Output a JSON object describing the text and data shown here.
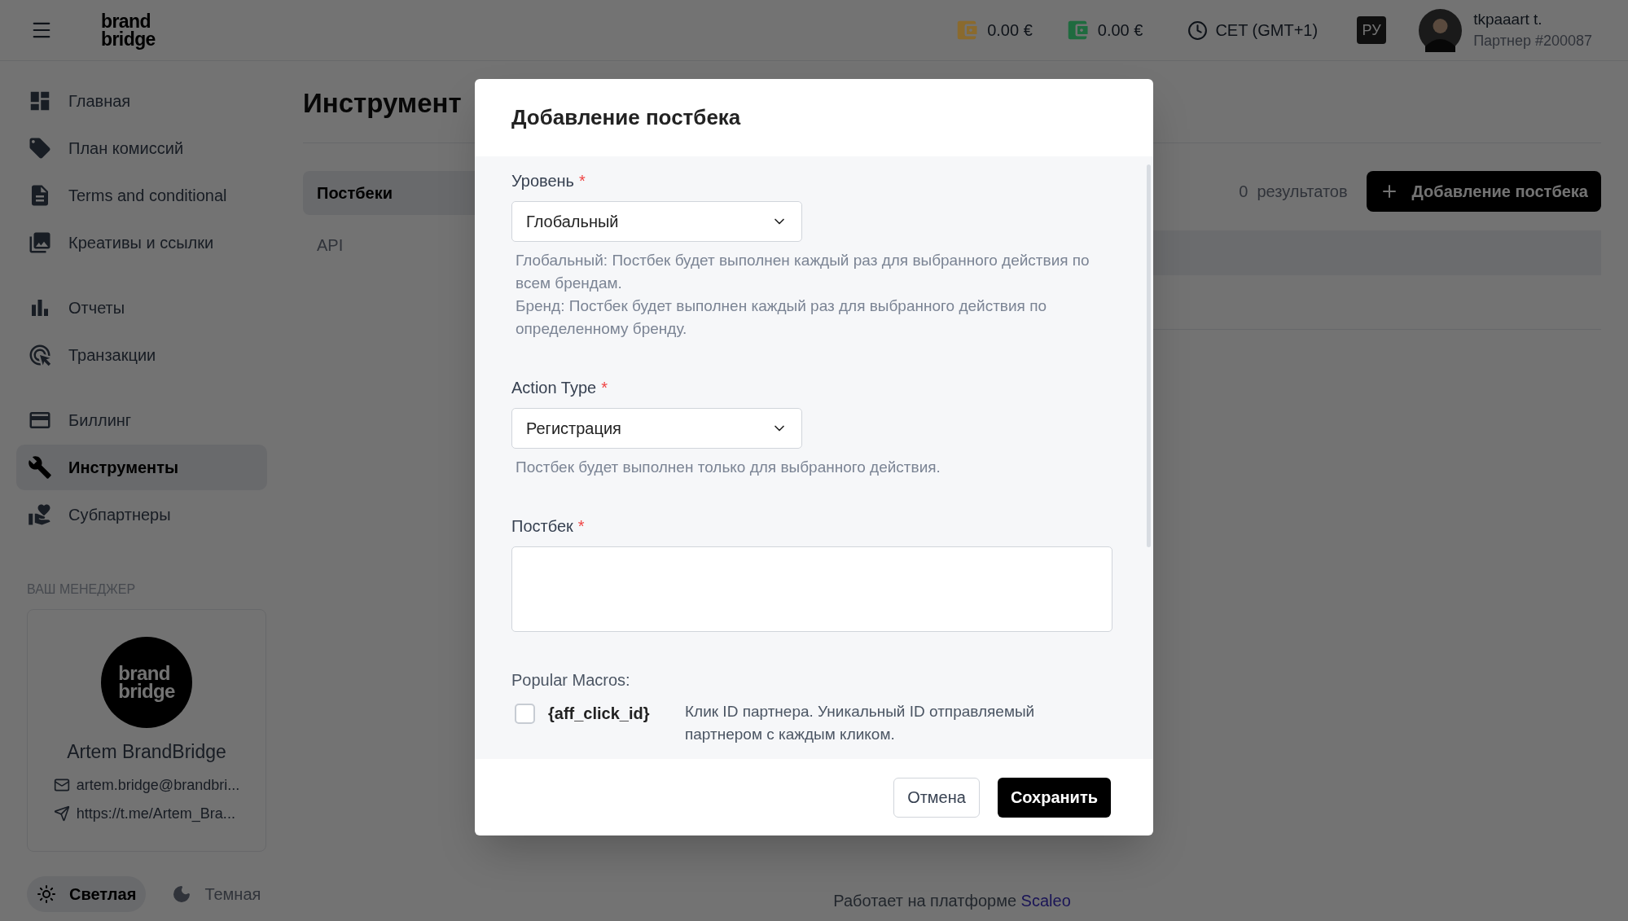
{
  "topbar": {
    "logo": [
      "brand",
      "bridge"
    ],
    "balances": [
      {
        "amount": "0.00 €",
        "color": "#8a6a2e"
      },
      {
        "amount": "0.00 €",
        "color": "#1f6b3f"
      }
    ],
    "timezone": "CET (GMT+1)",
    "language": "РУ",
    "user": {
      "name": "tkpaaart t.",
      "partner": "Партнер #200087"
    }
  },
  "sidebar": {
    "groups": [
      [
        {
          "label": "Главная",
          "selected": false
        },
        {
          "label": "План комиссий",
          "selected": false
        },
        {
          "label": "Terms and conditional",
          "selected": false
        },
        {
          "label": "Креативы и ссылки",
          "selected": false
        }
      ],
      [
        {
          "label": "Отчеты",
          "selected": false
        },
        {
          "label": "Транзакции",
          "selected": false
        }
      ],
      [
        {
          "label": "Биллинг",
          "selected": false
        },
        {
          "label": "Инструменты",
          "selected": true
        },
        {
          "label": "Субпартнеры",
          "selected": false
        }
      ]
    ],
    "manager": {
      "label": "ВАШ МЕНЕДЖЕР",
      "logo": [
        "brand",
        "bridge"
      ],
      "name": "Artem BrandBridge",
      "email": "artem.bridge@brandbri...",
      "telegram": "https://t.me/Artem_Bra..."
    },
    "theme": [
      {
        "label": "Светлая",
        "selected": true
      },
      {
        "label": "Темная",
        "selected": false
      }
    ]
  },
  "page": {
    "title": "Инструмент",
    "tabs": [
      {
        "label": "Постбеки",
        "selected": true
      },
      {
        "label": "API",
        "selected": false
      }
    ],
    "results": {
      "count": "0",
      "label": "результатов"
    },
    "add_button": "Добавление постбека",
    "footer": {
      "text": "Работает на платформе",
      "link": "Scaleo"
    }
  },
  "modal": {
    "title": "Добавление постбека",
    "fields": [
      {
        "kind": "select",
        "label": "Уровень",
        "required_mark": "*",
        "value": "Глобальный",
        "help": [
          "Глобальный: Постбек будет выполнен каждый раз для выбранного действия по всем брендам.",
          "Бренд: Постбек будет выполнен каждый раз для выбранного действия по определенному бренду."
        ]
      },
      {
        "kind": "select",
        "label": "Action Type",
        "required_mark": "*",
        "value": "Регистрация",
        "help": [
          "Постбек будет выполнен только для выбранного действия."
        ]
      },
      {
        "kind": "textarea",
        "label": "Постбек",
        "required_mark": "*"
      }
    ],
    "macros": {
      "title": "Popular Macros:",
      "items": [
        {
          "code": "{aff_click_id}",
          "description": "Клик ID партнера. Уникальный ID отправляемый партнером с каждым кликом.",
          "checked": false
        }
      ]
    },
    "buttons": [
      {
        "label": "Отмена",
        "kind": "secondary"
      },
      {
        "label": "Сохранить",
        "kind": "primary"
      }
    ]
  }
}
